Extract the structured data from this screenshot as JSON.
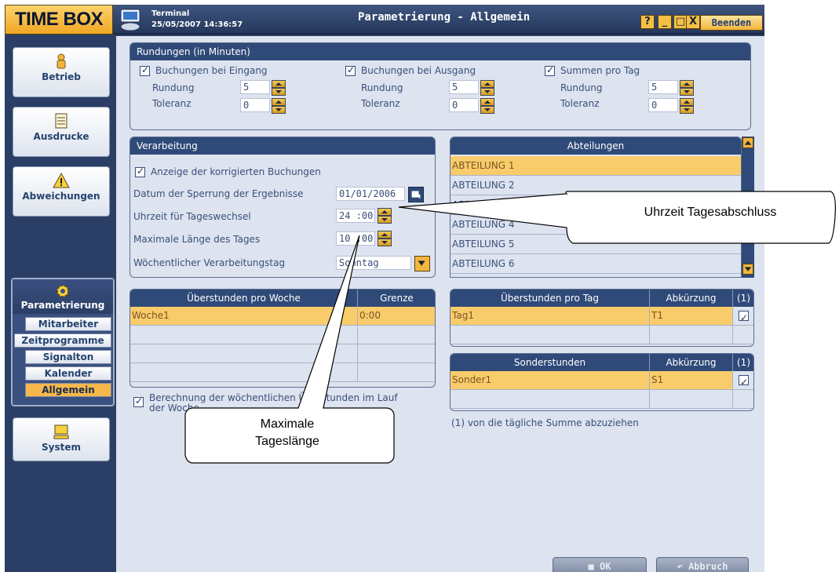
{
  "app": {
    "brand": "TIME BOX",
    "terminal_label": "Terminal",
    "terminal_datetime": "25/05/2007 14:36:57",
    "page_title": "Parametrierung - Allgemein",
    "help_glyph": "?",
    "minimize_glyph": "_",
    "maximize_glyph": "□",
    "close_glyph": "X",
    "exit_label": "Beenden"
  },
  "sidebar": {
    "items": [
      {
        "label": "Betrieb",
        "icon": "worker-icon"
      },
      {
        "label": "Ausdrucke",
        "icon": "document-icon"
      },
      {
        "label": "Abweichungen",
        "icon": "warning-icon"
      }
    ],
    "group": {
      "label": "Parametrierung",
      "icon": "gear-icon",
      "sub_items": [
        "Mitarbeiter",
        "Zeitprogramme",
        "Signalton",
        "Kalender",
        "Allgemein"
      ],
      "active": "Allgemein"
    },
    "system": {
      "label": "System",
      "icon": "computer-icon"
    }
  },
  "rundungen": {
    "title": "Rundungen (in Minuten)",
    "groups": [
      {
        "check_label": "Buchungen bei Eingang",
        "rundung_label": "Rundung",
        "rundung_value": "5",
        "toleranz_label": "Toleranz",
        "toleranz_value": "0"
      },
      {
        "check_label": "Buchungen bei Ausgang",
        "rundung_label": "Rundung",
        "rundung_value": "5",
        "toleranz_label": "Toleranz",
        "toleranz_value": "0"
      },
      {
        "check_label": "Summen pro Tag",
        "rundung_label": "Rundung",
        "rundung_value": "5",
        "toleranz_label": "Toleranz",
        "toleranz_value": "0"
      }
    ]
  },
  "verarbeitung": {
    "title": "Verarbeitung",
    "anzeige_label": "Anzeige der korrigierten Buchungen",
    "sperrung_label": "Datum der Sperrung der Ergebnisse",
    "sperrung_value": "01/01/2006",
    "tageswechsel_label": "Uhrzeit für Tageswechsel",
    "tageswechsel_value": "24 :00",
    "max_laenge_label": "Maximale Länge des Tages",
    "max_laenge_value": "10 :00",
    "verarbeitungstag_label": "Wöchentlicher Verarbeitungstag",
    "verarbeitungstag_value": "Sonntag"
  },
  "abteilungen": {
    "title": "Abteilungen",
    "items": [
      "ABTEILUNG 1",
      "ABTEILUNG 2",
      "ABTEILUNG 3",
      "ABTEILUNG 4",
      "ABTEILUNG 5",
      "ABTEILUNG 6"
    ],
    "selected_index": 0
  },
  "ueberstunden_woche": {
    "headers": [
      "Überstunden pro Woche",
      "Grenze"
    ],
    "rows": [
      [
        "Woche1",
        "0:00"
      ],
      [
        "",
        ""
      ],
      [
        "",
        ""
      ],
      [
        "",
        ""
      ]
    ],
    "berechnung_label_line1": "Berechnung der wöchentlichen Überstunden im Lauf",
    "berechnung_label_line2": "der Woche"
  },
  "ueberstunden_tag": {
    "headers": [
      "Überstunden pro Tag",
      "Abkürzung",
      "(1)"
    ],
    "rows": [
      [
        "Tag1",
        "T1",
        true
      ],
      [
        "",
        "",
        false
      ]
    ]
  },
  "sonderstunden": {
    "headers": [
      "Sonderstunden",
      "Abkürzung",
      "(1)"
    ],
    "rows": [
      [
        "Sonder1",
        "S1",
        true
      ],
      [
        "",
        "",
        false
      ]
    ],
    "footnote": "(1) von die tägliche Summe abzuziehen"
  },
  "footer": {
    "ok_label": "OK",
    "cancel_label": "Abbruch"
  },
  "callouts": {
    "tagesabschluss": "Uhrzeit Tagesabschluss",
    "tageslaenge_line1": "Maximale",
    "tageslaenge_line2": "Tageslänge"
  }
}
